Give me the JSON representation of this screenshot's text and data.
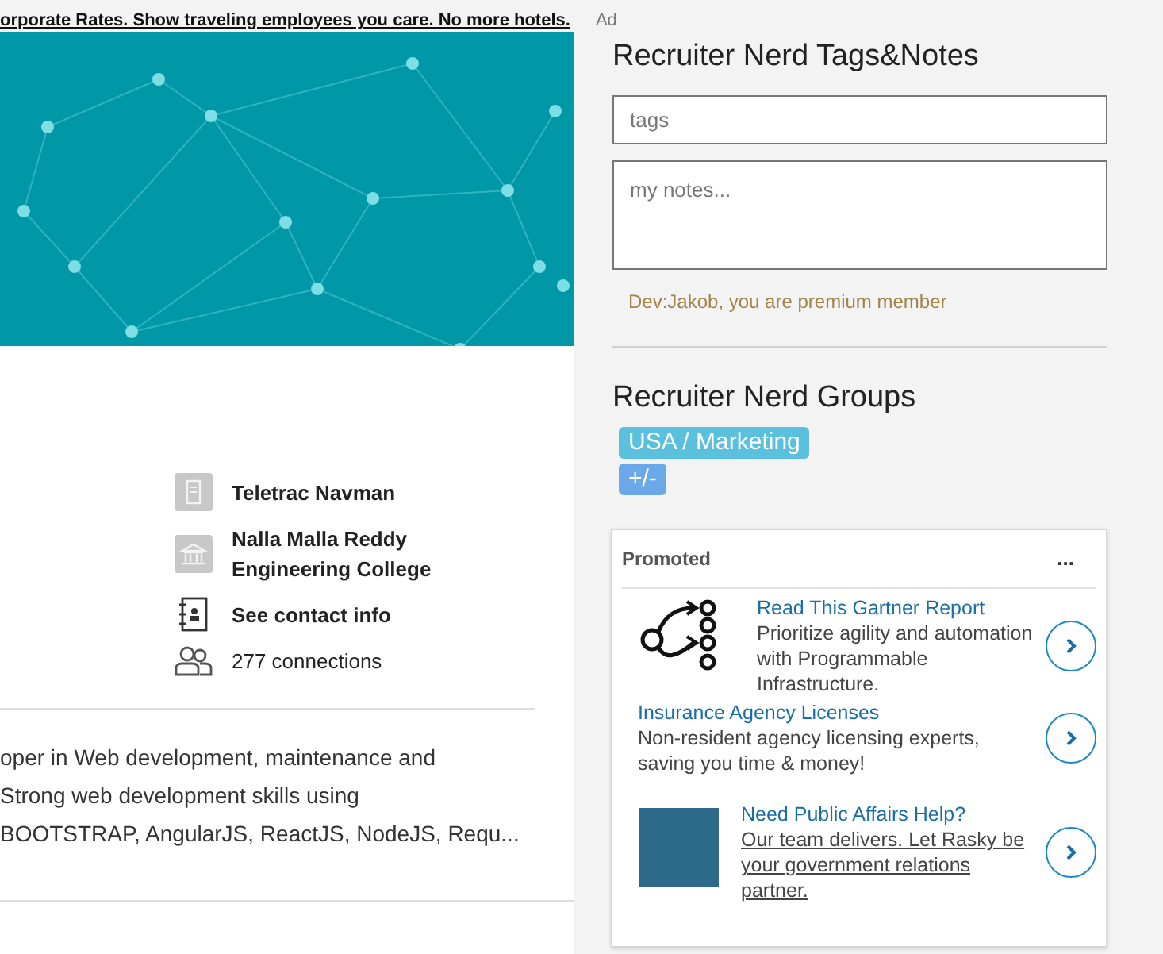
{
  "ad_banner": {
    "text": "orporate Rates. Show traveling employees you care. No more hotels.",
    "label": "Ad"
  },
  "profile": {
    "facts": [
      {
        "kind": "company",
        "text": "Teletrac Navman"
      },
      {
        "kind": "school",
        "text": "Nalla Malla Reddy Engineering College"
      },
      {
        "kind": "contact",
        "text": "See contact info"
      },
      {
        "kind": "connections",
        "text": "277 connections"
      }
    ],
    "summary_lines": [
      "oper in Web development, maintenance and",
      "Strong web development skills using",
      "BOOTSTRAP, AngularJS, ReactJS, NodeJS, Requ..."
    ]
  },
  "tags_notes": {
    "title": "Recruiter Nerd Tags&Notes",
    "tags": {
      "placeholder": "tags"
    },
    "notes": {
      "placeholder": "my notes..."
    },
    "premium_message": "Dev:Jakob, you are premium member"
  },
  "groups": {
    "title": "Recruiter Nerd Groups",
    "items": [
      {
        "label": "USA / Marketing",
        "color": "#5bc0de"
      },
      {
        "label": "+/-",
        "color": "#6aa8e8"
      }
    ]
  },
  "promoted": {
    "title": "Promoted",
    "menu": "...",
    "ads": [
      {
        "kind": "diagram",
        "title": "Read This Gartner Report",
        "body": "Prioritize agility and automation with Programmable Infrastructure.",
        "underlined": false
      },
      {
        "kind": "text",
        "title": "Insurance Agency Licenses",
        "body": "Non-resident agency licensing experts, saving you time & money!",
        "underlined": false
      },
      {
        "kind": "photo",
        "title": "Need Public Affairs Help?",
        "body": "Our team delivers. Let Rasky be your government relations partner.",
        "underlined": true
      }
    ]
  }
}
